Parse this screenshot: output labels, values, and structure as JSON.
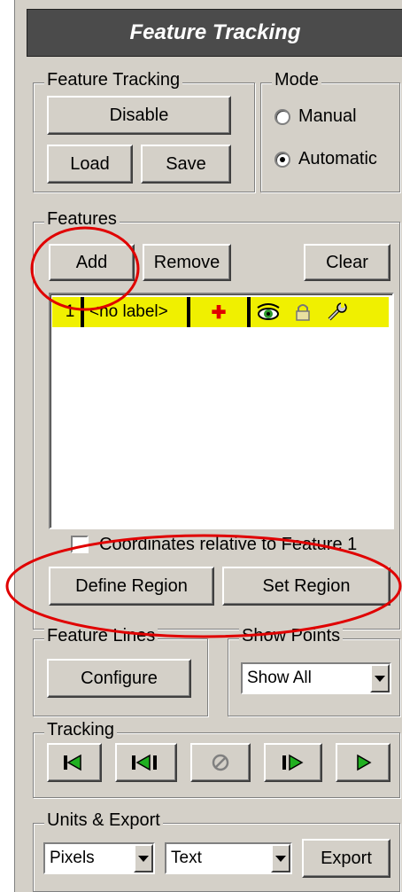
{
  "title": "Feature Tracking",
  "feature_tracking": {
    "legend": "Feature Tracking",
    "disable": "Disable",
    "load": "Load",
    "save": "Save"
  },
  "mode": {
    "legend": "Mode",
    "manual": "Manual",
    "automatic": "Automatic",
    "selected": "Automatic"
  },
  "features": {
    "legend": "Features",
    "add": "Add",
    "remove": "Remove",
    "clear": "Clear",
    "rows": [
      {
        "index": "1",
        "label": "<no label>",
        "marker": "✚"
      }
    ],
    "relative_checkbox": "Coordinates relative to Feature 1",
    "relative_checked": false,
    "define_region": "Define Region",
    "set_region": "Set Region"
  },
  "feature_lines": {
    "legend": "Feature Lines",
    "configure": "Configure"
  },
  "show_points": {
    "legend": "Show Points",
    "value": "Show All"
  },
  "tracking": {
    "legend": "Tracking"
  },
  "units_export": {
    "legend": "Units & Export",
    "units": "Pixels",
    "format": "Text",
    "export": "Export"
  },
  "colors": {
    "highlight": "#ff0000",
    "row_bg": "#f0f000",
    "panel": "#d4d0c8"
  }
}
